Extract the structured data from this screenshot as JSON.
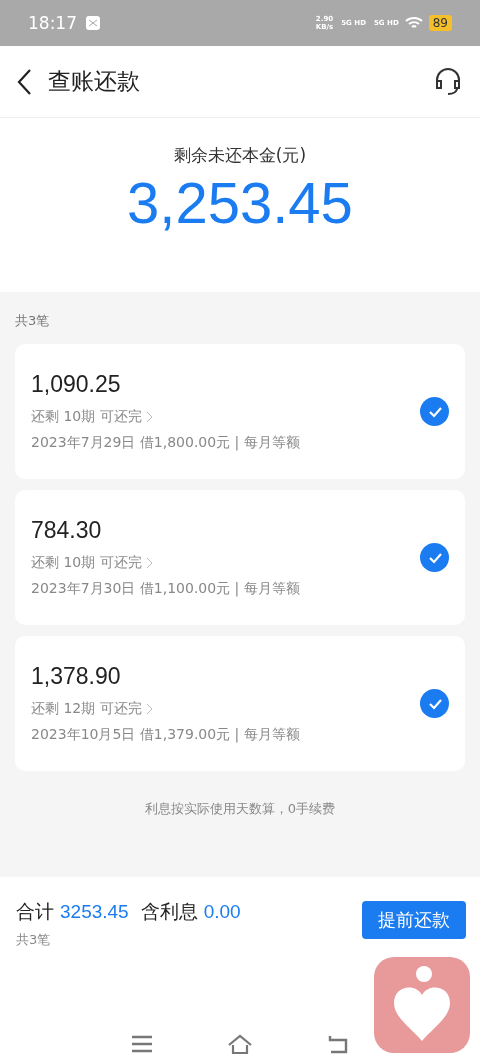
{
  "status_bar": {
    "time": "18:17",
    "net_speed": "2.90",
    "net_unit": "KB/s",
    "sim_1": "5G HD",
    "sim_2": "5G HD",
    "battery": "89"
  },
  "header": {
    "title": "查账还款"
  },
  "summary": {
    "label": "剩余未还本金(元)",
    "amount": "3,253.45"
  },
  "list": {
    "count": "共3笔",
    "loans": [
      {
        "amount": "1,090.25",
        "remaining": "还剩 10期 可还完",
        "detail": "2023年7月29日 借1,800.00元 | 每月等额",
        "checked": true
      },
      {
        "amount": "784.30",
        "remaining": "还剩 10期 可还完",
        "detail": "2023年7月30日 借1,100.00元 | 每月等额",
        "checked": true
      },
      {
        "amount": "1,378.90",
        "remaining": "还剩 12期 可还完",
        "detail": "2023年10月5日 借1,379.00元 | 每月等额",
        "checked": true
      }
    ],
    "note": "利息按实际使用天数算，0手续费"
  },
  "footer": {
    "total_label": "合计",
    "total": "3253.45",
    "interest_label": "含利息",
    "interest": "0.00",
    "count": "共3笔",
    "button": "提前还款"
  }
}
